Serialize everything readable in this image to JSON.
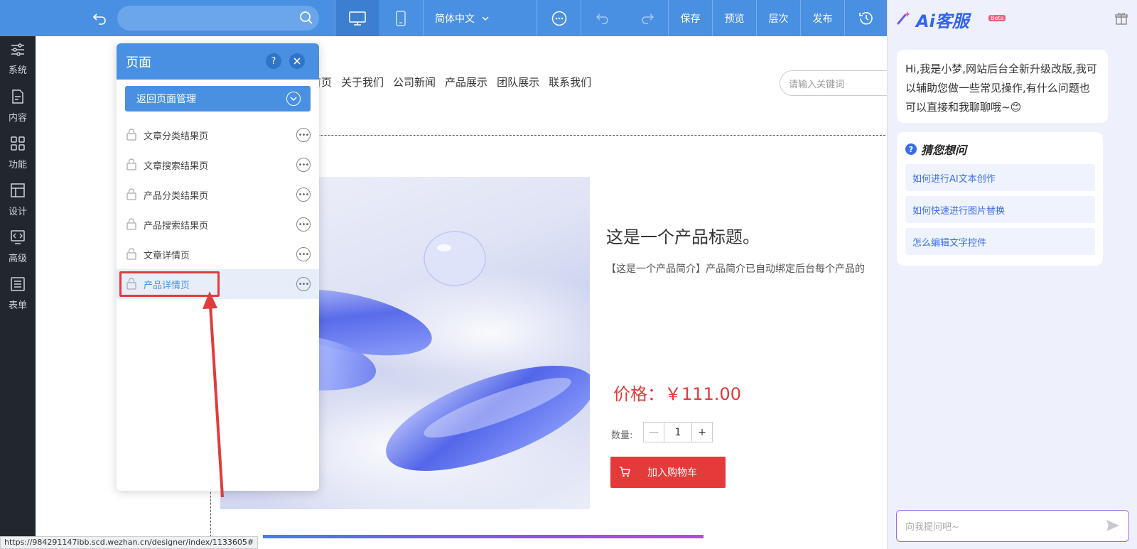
{
  "toolbar": {
    "search_placeholder": "",
    "language": "简体中文",
    "save": "保存",
    "preview": "预览",
    "layers": "层次",
    "publish": "发布"
  },
  "sidebar": {
    "items": [
      {
        "label": "系统",
        "icon": "sliders-icon"
      },
      {
        "label": "内容",
        "icon": "document-icon"
      },
      {
        "label": "功能",
        "icon": "grid-icon"
      },
      {
        "label": "设计",
        "icon": "layout-icon"
      },
      {
        "label": "高级",
        "icon": "code-icon"
      },
      {
        "label": "表单",
        "icon": "list-icon"
      }
    ]
  },
  "panel": {
    "title": "页面",
    "help": "?",
    "back_label": "返回页面管理",
    "pages": [
      {
        "label": "文章分类结果页"
      },
      {
        "label": "文章搜索结果页"
      },
      {
        "label": "产品分类结果页"
      },
      {
        "label": "产品搜索结果页"
      },
      {
        "label": "文章详情页"
      },
      {
        "label": "产品详情页"
      }
    ]
  },
  "site": {
    "nav": [
      "首页",
      "关于我们",
      "公司新闻",
      "产品展示",
      "团队展示",
      "联系我们"
    ],
    "search_placeholder": "请输入关键词",
    "product_title": "这是一个产品标题。",
    "product_intro": "【这是一个产品简介】产品简介已自动绑定后台每个产品的",
    "price": "价格：￥111.00",
    "qty_label": "数量:",
    "qty_value": "1",
    "qty_minus": "—",
    "qty_plus": "+",
    "cart_label": "加入购物车"
  },
  "ai": {
    "title": "Ai客服",
    "beta": "Beta",
    "greeting": "Hi,我是小梦,网站后台全新升级改版,我可以辅助您做一些常见操作,有什么问题也可以直接和我聊聊哦~😊",
    "guess_title": "猜您想问",
    "questions": [
      "如何进行AI文本创作",
      "如何快速进行图片替换",
      "怎么编辑文字控件"
    ],
    "input_placeholder": "向我提问吧~"
  },
  "status_url": "https://984291147ibb.scd.wezhan.cn/designer/index/1133605#",
  "colors": {
    "primary": "#4a90e2",
    "danger": "#e53a3a",
    "ai_accent": "#3a6ee8"
  }
}
